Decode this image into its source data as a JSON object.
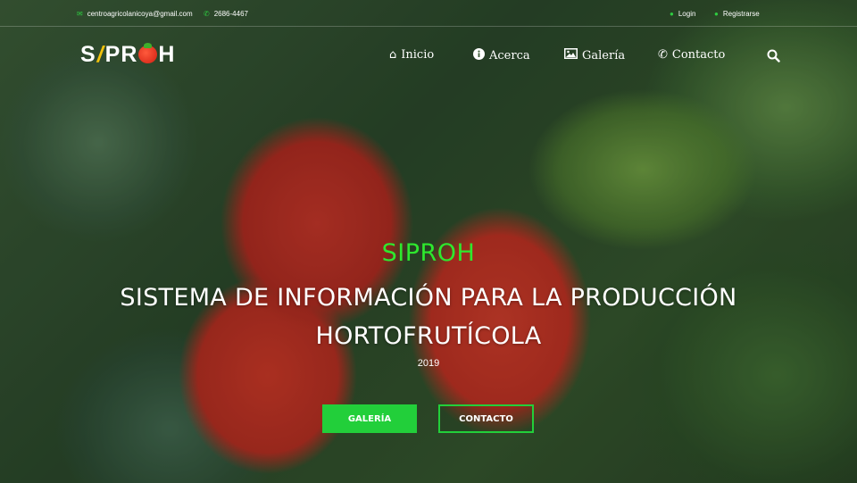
{
  "topbar": {
    "email": "centroagricolanicoya@gmail.com",
    "phone": "2686-4467",
    "login": "Login",
    "register": "Registrarse"
  },
  "brand": {
    "logo_part1": "S",
    "logo_part2": "PR",
    "logo_part3": "H"
  },
  "nav": {
    "items": [
      {
        "label": "Inicio",
        "icon": "home-icon"
      },
      {
        "label": "Acerca",
        "icon": "info-icon"
      },
      {
        "label": "Galería",
        "icon": "image-icon"
      },
      {
        "label": "Contacto",
        "icon": "phone-icon"
      }
    ],
    "search_icon": "search-icon"
  },
  "hero": {
    "tag": "SIPROH",
    "title_line1": "SISTEMA DE INFORMACIÓN PARA LA PRODUCCIÓN",
    "title_line2": "HORTOFRUTÍCOLA",
    "year": "2019",
    "primary_button": "GALERÍA",
    "secondary_button": "CONTACTO"
  },
  "colors": {
    "accent": "#22cf3a",
    "tag_green": "#2ee82e",
    "logo_yellow": "#f2c20d",
    "logo_red": "#d11f12"
  }
}
